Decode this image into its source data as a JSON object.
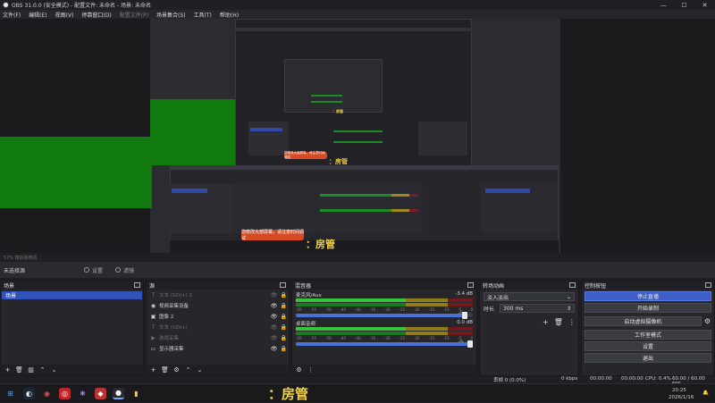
{
  "window": {
    "title": "OBS 31.0.0 (安全模式) - 配置文件: 未命名 - 场景: 未命名",
    "minimize": "—",
    "maximize": "☐",
    "close": "✕"
  },
  "menu": [
    "文件(F)",
    "编辑(E)",
    "视图(V)",
    "停靠窗口(D)",
    "配置文件(P)",
    "场景集合(S)",
    "工具(T)",
    "帮助(H)"
  ],
  "menu_dim": [
    false,
    false,
    false,
    false,
    true,
    false,
    false,
    false
  ],
  "preview": {
    "toast_small": "您修改大部屏幕，请注意时间调试",
    "toast_large": "您修改大部屏幕，请注意时间调试",
    "rocket_text": "：房管",
    "status_text_left": "57% 模拟摄像机"
  },
  "scene_strip": {
    "label": "未选择源",
    "properties": "设置",
    "filters": "滤镜"
  },
  "docks": {
    "scenes": {
      "title": "场景",
      "items": [
        "场景"
      ]
    },
    "sources": {
      "title": "源",
      "items": [
        {
          "icon": "text-icon",
          "glyph": "T",
          "name": "文本 (GDI+) 2",
          "dim": true
        },
        {
          "icon": "camera-icon",
          "glyph": "◉",
          "name": "视频采集设备",
          "dim": false
        },
        {
          "icon": "image-icon",
          "glyph": "▣",
          "name": "图像 2",
          "dim": false
        },
        {
          "icon": "text-icon",
          "glyph": "T",
          "name": "文本 (GDI+)",
          "dim": true
        },
        {
          "icon": "game-icon",
          "glyph": "▶",
          "name": "游戏采集",
          "dim": true
        },
        {
          "icon": "monitor-icon",
          "glyph": "▭",
          "name": "显示器采集",
          "dim": false
        }
      ]
    },
    "mixer": {
      "title": "混音器",
      "channels": [
        {
          "name": "麦克风/Aux",
          "db": "-3.4 dB",
          "level": 0.97,
          "active": true
        },
        {
          "name": "桌面音频",
          "db": "0.0 dB",
          "level": 1.0,
          "active": true
        }
      ],
      "ticks": [
        "-60",
        "-55",
        "-50",
        "-45",
        "-40",
        "-35",
        "-30",
        "-25",
        "-20",
        "-15",
        "-10",
        "-5",
        "0"
      ]
    },
    "transitions": {
      "title": "转场动画",
      "selected": "淡入淡出",
      "duration_label": "时长",
      "duration_value": "300 ms"
    },
    "controls": {
      "title": "控制按钮",
      "buttons": [
        "停止直播",
        "开始录制",
        "启动虚拟摄像机",
        "工作室模式",
        "设置",
        "退出"
      ]
    }
  },
  "status_bar": {
    "dropped": "丢帧 0 (0.0%)",
    "bitrate": "0 kbps",
    "live_time": "00:00:00",
    "rec_time": "00:00:00",
    "cpu": "CPU: 0.4%",
    "fps": "60.00 / 60.00 FPS"
  },
  "taskbar": {
    "time": "20:25",
    "date": "2026/1/16"
  },
  "colors": {
    "accent": "#3d5ec8",
    "green": "#117a0f",
    "toast": "#d64b24",
    "rocket": "#f2d242"
  }
}
